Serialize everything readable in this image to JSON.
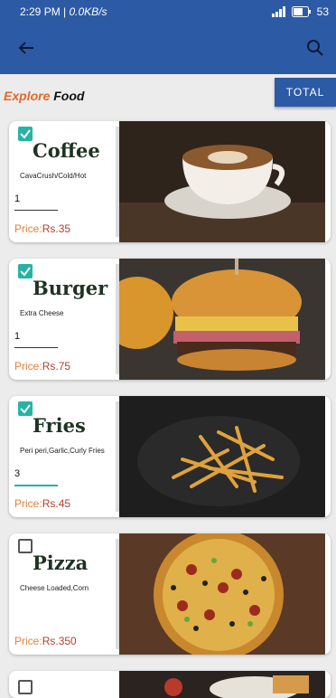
{
  "status": {
    "time": "2:29 PM",
    "speed": "0.0KB/s",
    "battery": "53"
  },
  "header": {
    "explore_word1": "Explore",
    "explore_word2": "Food",
    "total_label": "TOTAL"
  },
  "items": [
    {
      "name": "Coffee",
      "desc": "CavaCrush/Cold/Hot",
      "qty": "1",
      "price_label": "Price:",
      "price_value": "Rs.35",
      "checked": true
    },
    {
      "name": "Burger",
      "desc": "Extra Cheese",
      "qty": "1",
      "price_label": "Price:",
      "price_value": "Rs.75",
      "checked": true
    },
    {
      "name": "Fries",
      "desc": "Peri peri,Garlic,Curly Fries",
      "qty": "3",
      "price_label": "Price:",
      "price_value": "Rs.45",
      "checked": true
    },
    {
      "name": "Pizza",
      "desc": "Cheese Loaded,Corn",
      "qty": "",
      "price_label": "Price:",
      "price_value": "Rs.350",
      "checked": false
    }
  ],
  "colors": {
    "primary": "#2d5aa4",
    "accent": "#26b3a6",
    "price": "#b3402b"
  }
}
